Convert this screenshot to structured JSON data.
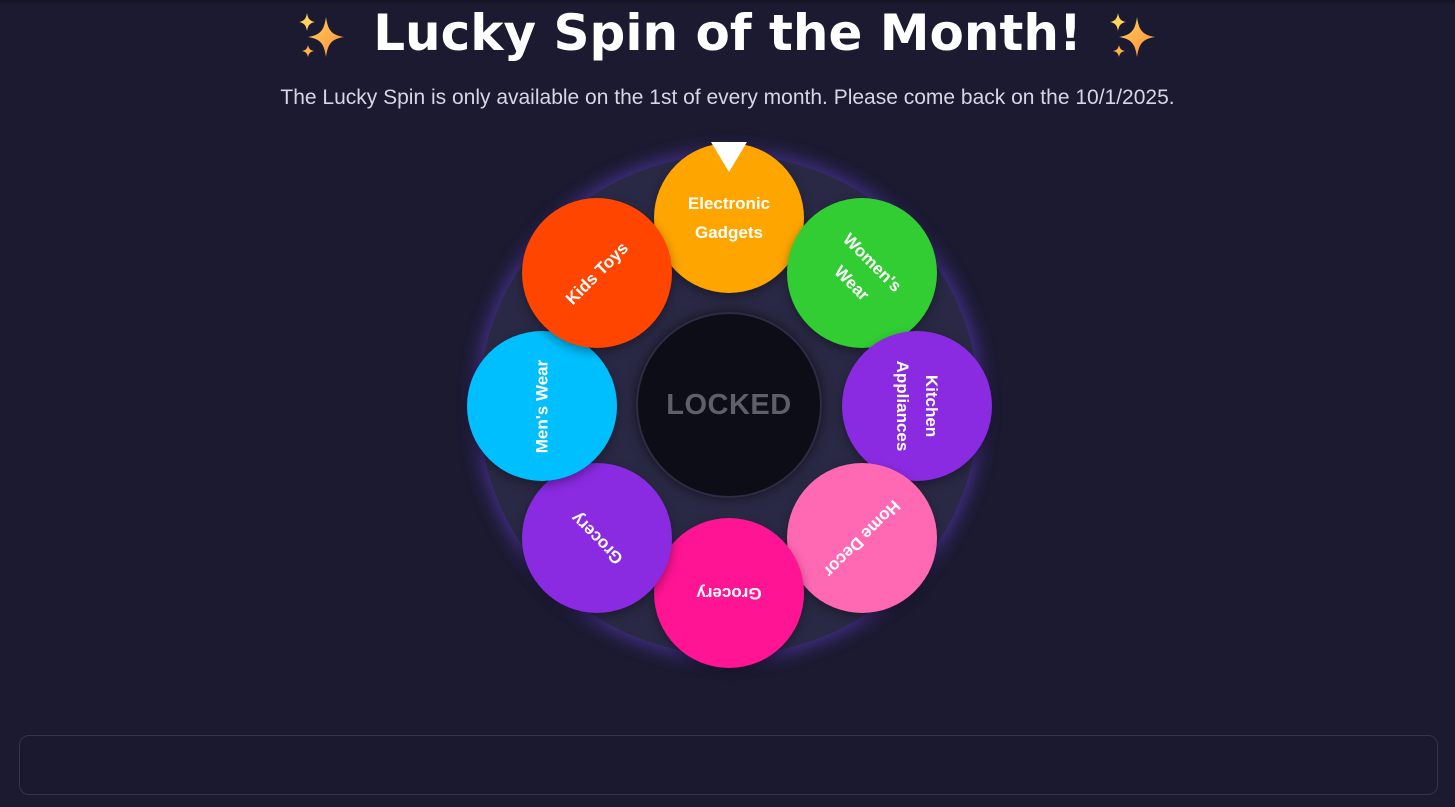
{
  "header": {
    "title": "Lucky Spin of the Month!",
    "spark_icon": "sparkles-icon"
  },
  "subtitle": "The Lucky Spin is only available on the 1st of every month. Please come back on the 10/1/2025.",
  "wheel": {
    "segments": [
      {
        "label": "Electronic Gadgets",
        "color": "#ffa500"
      },
      {
        "label": "Women's Wear",
        "color": "#32cd32"
      },
      {
        "label": "Kitchen Appliances",
        "color": "#8a2be2"
      },
      {
        "label": "Home Decor",
        "color": "#ff69b4"
      },
      {
        "label": "Grocery",
        "color": "#ff1493"
      },
      {
        "label": "Grocery",
        "color": "#8a2be2"
      },
      {
        "label": "Men's Wear",
        "color": "#00bfff"
      },
      {
        "label": "Kids Toys",
        "color": "#ff4500"
      }
    ],
    "center_label": "LOCKED"
  },
  "colors": {
    "background": "#1b1a30",
    "glow": "#7c4dff"
  }
}
